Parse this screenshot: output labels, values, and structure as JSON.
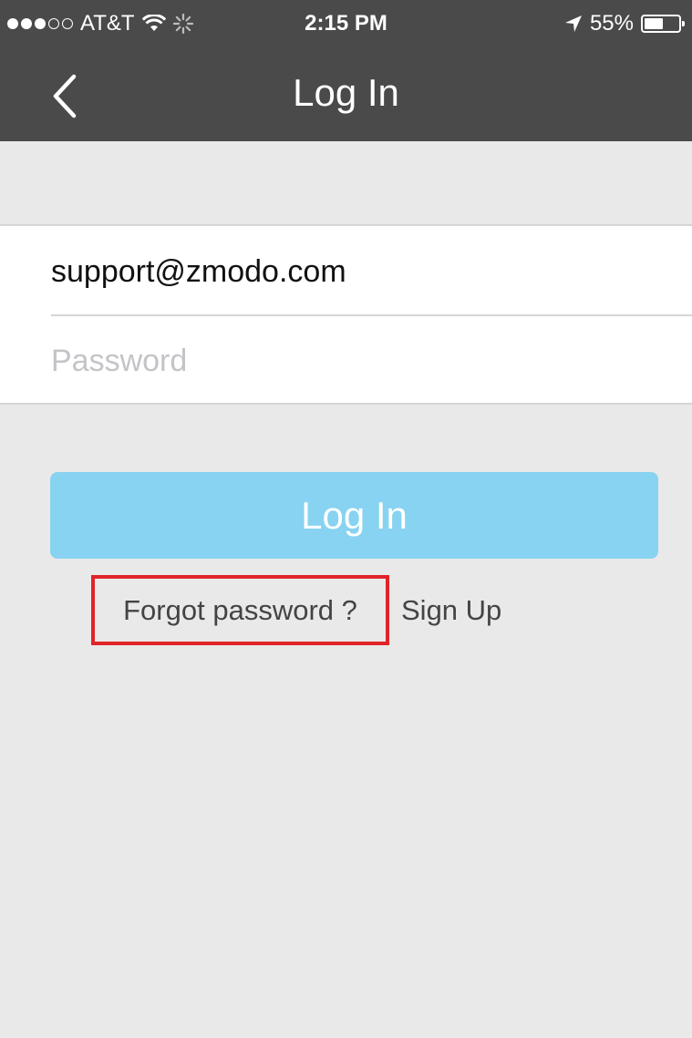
{
  "status_bar": {
    "carrier": "AT&T",
    "time": "2:15 PM",
    "battery_percent": "55%",
    "battery_level": 0.55,
    "icons": [
      "signal-dots-icon",
      "wifi-icon",
      "activity-spinner-icon",
      "location-arrow-icon",
      "battery-icon"
    ]
  },
  "nav": {
    "title": "Log In",
    "back_icon": "chevron-left-icon"
  },
  "form": {
    "email_value": "support@zmodo.com",
    "password_placeholder": "Password"
  },
  "actions": {
    "login_label": "Log In",
    "forgot_password_label": "Forgot password ?",
    "signup_label": "Sign Up"
  },
  "colors": {
    "nav_background": "#4a4a4a",
    "page_background": "#e9e9e9",
    "login_button": "#87d3f1",
    "highlight_box": "#e2232a"
  }
}
